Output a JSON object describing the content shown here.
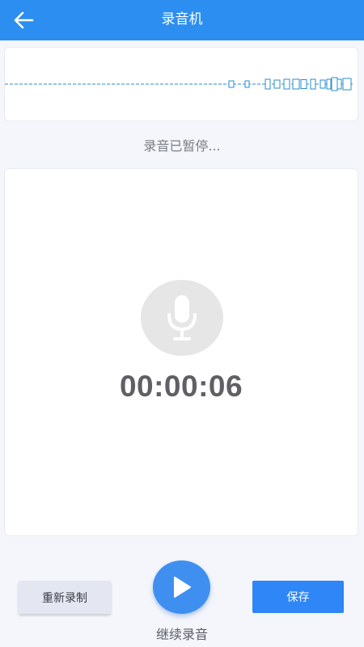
{
  "header": {
    "title": "录音机",
    "back_icon": "arrow-left-icon"
  },
  "status": {
    "text": "录音已暂停..."
  },
  "recorder": {
    "mic_icon": "microphone-icon",
    "timer": "00:00:06"
  },
  "actions": {
    "rerecord_label": "重新录制",
    "play_icon": "play-icon",
    "play_label": "继续录音",
    "save_label": "保存"
  },
  "colors": {
    "accent": "#2b8ef0",
    "waveform": "#2a8ec8",
    "button_primary": "#2f86f6"
  }
}
